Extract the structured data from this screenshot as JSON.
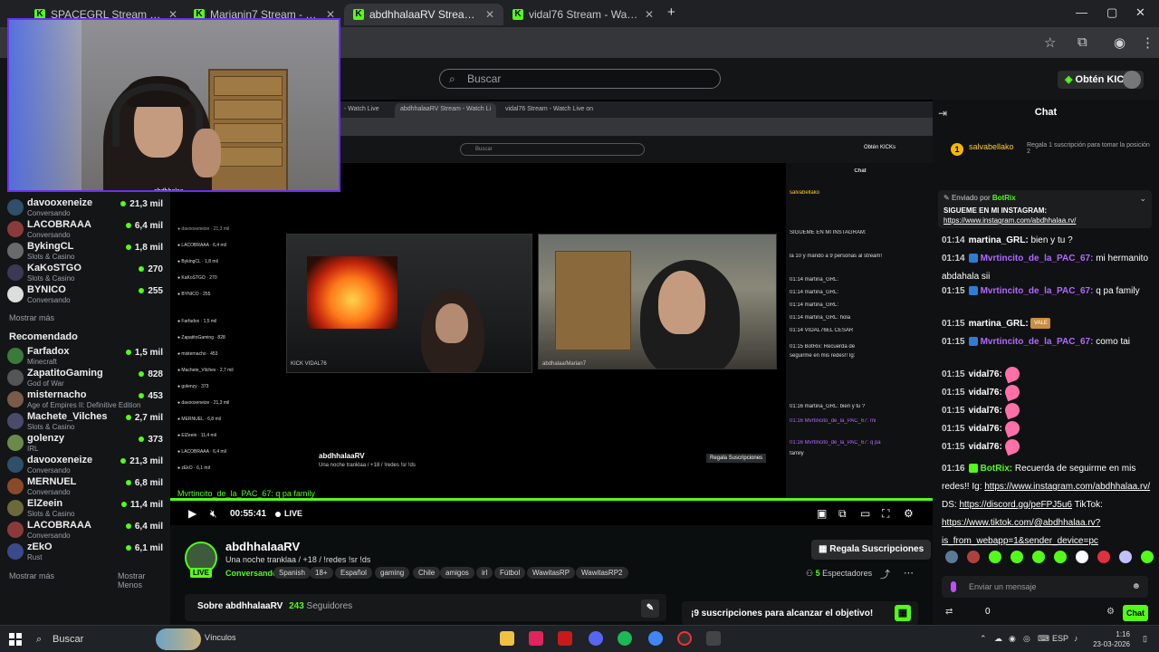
{
  "browser": {
    "tabs": [
      {
        "label": "SPACEGRL Stream - Watch Live",
        "active": false
      },
      {
        "label": "Marianin7 Stream - Watch Live",
        "active": false
      },
      {
        "label": "abdhhalaaRV Stream - Watch Li",
        "active": true
      },
      {
        "label": "vidal76 Stream - Watch Live on",
        "active": false
      }
    ],
    "new_tab": "+",
    "close_glyph": "✕",
    "window_controls": {
      "minimize": "—",
      "maximize": "▢",
      "close": "✕"
    }
  },
  "header": {
    "search_placeholder": "Buscar",
    "kicks_button": "Obtén KICKs"
  },
  "sidebar": {
    "following": [
      {
        "name": "davooxeneize",
        "sub": "Conversando",
        "viewers": "21,3 mil"
      },
      {
        "name": "LACOBRAAA",
        "sub": "Conversando",
        "viewers": "6,4 mil"
      },
      {
        "name": "BykingCL",
        "sub": "Slots & Casino",
        "viewers": "1,8 mil"
      },
      {
        "name": "KaKoSTGO",
        "sub": "Slots & Casino",
        "viewers": "270"
      },
      {
        "name": "BYNICO",
        "sub": "Conversando",
        "viewers": "255"
      }
    ],
    "show_more": "Mostrar más",
    "recommended_heading": "Recomendado",
    "recommended": [
      {
        "name": "Farfadox",
        "sub": "Minecraft",
        "viewers": "1,5 mil"
      },
      {
        "name": "ZapatitoGaming",
        "sub": "God of War",
        "viewers": "828"
      },
      {
        "name": "misternacho",
        "sub": "Age of Empires II: Definitive Edition",
        "viewers": "453"
      },
      {
        "name": "Machete_Vilches",
        "sub": "Slots & Casino",
        "viewers": "2,7 mil"
      },
      {
        "name": "golenzy",
        "sub": "IRL",
        "viewers": "373"
      },
      {
        "name": "davooxeneize",
        "sub": "Conversando",
        "viewers": "21,3 mil"
      },
      {
        "name": "MERNUEL",
        "sub": "Conversando",
        "viewers": "6,8 mil"
      },
      {
        "name": "ElZeein",
        "sub": "Slots & Casino",
        "viewers": "11,4 mil"
      },
      {
        "name": "LACOBRAAA",
        "sub": "Conversando",
        "viewers": "6,4 mil"
      },
      {
        "name": "zEkO",
        "sub": "Rust",
        "viewers": "6,1 mil"
      }
    ],
    "show_more_2": "Mostrar más",
    "show_less": "Mostrar Menos"
  },
  "video": {
    "nested_tabs": [
      "- Watch Live",
      "abdhhalaaRV Stream - Watch Li",
      "vidal76 Stream - Watch Live on"
    ],
    "nested_search": "Buscar",
    "nested_kicks": "Obtén KICKs",
    "nested_chat_title": "Chat",
    "cam_left_caption": "KICK VIDAL76",
    "cam_right_caption": "abdhalaa/Marian7",
    "nested_streamer": "abdhhalaaRV",
    "nested_title": "Una noche tranklaa / +18 / !redes !sr !ds",
    "nested_sub_button": "Regala Suscripciones",
    "overlay_chat": "Mvrtincito_de_la_PAC_67: q pa family",
    "time": "00:55:41",
    "live_label": "LIVE"
  },
  "streamer": {
    "name": "abdhhalaaRV",
    "title": "Una noche tranklaa / +18 / !redes !sr !ds",
    "live_badge": "LIVE",
    "category": "Conversando",
    "tags": [
      "Spanish",
      "18+",
      "Español",
      "gaming",
      "Chile",
      "amigos",
      "irl",
      "Fútbol",
      "WawitasRP",
      "WawitasRP2"
    ],
    "sub_button": "Regala Suscripciones",
    "viewers": "5",
    "viewers_label": "Espectadores",
    "about_label": "Sobre abdhhalaaRV",
    "followers": "243",
    "followers_label": "Seguidores",
    "goal_text": "¡9 suscripciones para alcanzar el objetivo!"
  },
  "chat": {
    "title": "Chat",
    "sub_user": "salvabellako",
    "sub_count": "1",
    "sub_desc": "Regala 1 suscripción para tomar la posición 2",
    "pinned_by": "Enviado por",
    "pinned_user": "BotRix",
    "pinned_line1": "SIGUEME EN MI INSTAGRAM:",
    "pinned_link": "https://www.instagram.com/abdhhalaa.rv/",
    "messages": [
      {
        "time": "01:14",
        "user": "martina_GRL:",
        "text": "bien y tu ?",
        "color": "#ffffff"
      },
      {
        "time": "01:14",
        "user": "Mvrtincito_de_la_PAC_67:",
        "text": "mi hermanito abdahala sii",
        "color": "#b069ff"
      },
      {
        "time": "01:15",
        "user": "Mvrtincito_de_la_PAC_67:",
        "text": "q pa family",
        "color": "#b069ff"
      },
      {
        "time": "01:15",
        "user": "martina_GRL:",
        "text": "",
        "color": "#ffffff"
      },
      {
        "time": "01:15",
        "user": "Mvrtincito_de_la_PAC_67:",
        "text": "como tai",
        "color": "#b069ff"
      },
      {
        "time": "01:15",
        "user": "vidal76:",
        "text": "",
        "color": "#ffffff"
      },
      {
        "time": "01:15",
        "user": "vidal76:",
        "text": "",
        "color": "#ffffff"
      },
      {
        "time": "01:15",
        "user": "vidal76:",
        "text": "",
        "color": "#ffffff"
      },
      {
        "time": "01:15",
        "user": "vidal76:",
        "text": "",
        "color": "#ffffff"
      },
      {
        "time": "01:15",
        "user": "vidal76:",
        "text": "",
        "color": "#ffffff"
      }
    ],
    "vale_emote": "VALE",
    "bot_time": "01:16",
    "bot_user": "BotRix:",
    "bot_text": "Recuerda de seguirme en mis redes!! Ig:",
    "bot_link1": "https://www.instagram.com/abdhhalaa.rv/",
    "bot_ds": "DS:",
    "bot_link2": "https://discord.gg/peFPJ5u6",
    "bot_tt": "TikTok:",
    "bot_link3": "https://www.tiktok.com/@abdhhalaa.rv?is_from_webapp=1&sender_device=pc",
    "input_placeholder": "Enviar un mensaje",
    "kicks_count": "0",
    "chat_button": "Chat"
  },
  "webcam": {
    "caption": "abdhhalaa"
  },
  "taskbar": {
    "search": "Buscar",
    "vinculos": "Vínculos",
    "lang": "ESP",
    "time": "1:16",
    "date": "23-03-2026"
  },
  "colors": {
    "kick_green": "#53fc18",
    "purple_user": "#b069ff"
  }
}
